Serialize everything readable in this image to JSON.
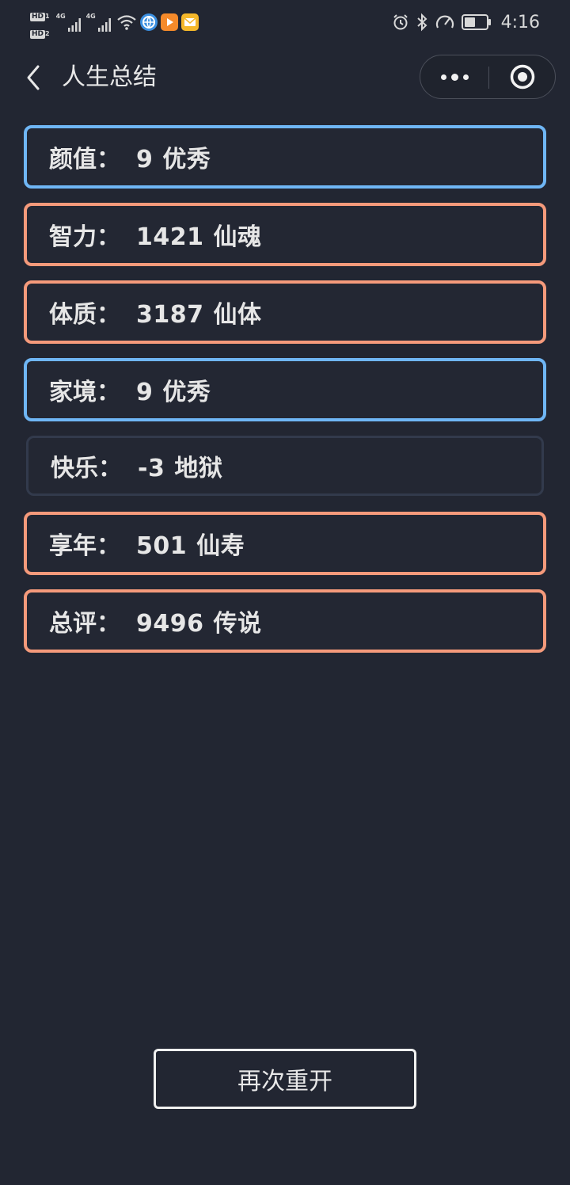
{
  "status_bar": {
    "sim1_badge": "HD",
    "sim1_index": "1",
    "sim2_badge": "HD",
    "sim2_index": "2",
    "signal1_label": "4G",
    "signal2_label": "4G",
    "time": "4:16",
    "icons": [
      "wifi-icon",
      "browser-app-icon",
      "video-app-icon",
      "mail-app-icon",
      "alarm-icon",
      "bluetooth-icon",
      "speed-icon",
      "battery-icon"
    ],
    "battery_level": 0.5
  },
  "nav": {
    "title": "人生总结",
    "back_icon": "chevron-left-icon",
    "more_icon": "more-dots-icon",
    "close_icon": "target-circle-icon"
  },
  "results": [
    {
      "label": "颜值：",
      "value": "9",
      "grade": "优秀",
      "style": "blue"
    },
    {
      "label": "智力：",
      "value": "1421",
      "grade": "仙魂",
      "style": "orange"
    },
    {
      "label": "体质：",
      "value": "3187",
      "grade": "仙体",
      "style": "orange"
    },
    {
      "label": "家境：",
      "value": "9",
      "grade": "优秀",
      "style": "blue"
    },
    {
      "label": "快乐：",
      "value": "-3",
      "grade": "地狱",
      "style": "dim"
    },
    {
      "label": "享年：",
      "value": "501",
      "grade": "仙寿",
      "style": "orange"
    },
    {
      "label": "总评：",
      "value": "9496",
      "grade": "传说",
      "style": "orange"
    }
  ],
  "restart_button": {
    "label": "再次重开"
  },
  "colors": {
    "background": "#222632",
    "blue_border": "#6fb6f5",
    "orange_border": "#f59a7b",
    "dim_border": "#323a4c",
    "text": "#e6e6e6"
  }
}
